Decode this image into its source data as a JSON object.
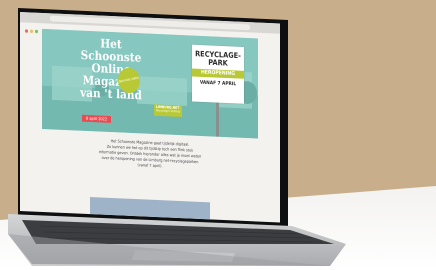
{
  "magazine": {
    "title_lines": [
      "Het",
      "Schoonste",
      "Online",
      "Magazine",
      "van 't land"
    ],
    "date_badge": "8 april 2022",
    "special_badge": "Speciale editie",
    "brand_name": "LIMBURG.NET",
    "brand_sub": "Recyclage Limburg"
  },
  "sign": {
    "line1": "RECYCLAGE-",
    "line2": "PARK",
    "line3": "HEROPENING",
    "line4": "VANAF 7 APRIL"
  },
  "intro_lines": [
    "Het Schoonste Magazine gaat tijdelijk digitaal.",
    "Zo kunnen we het op dit tijdstip toch een flink stuk",
    "informatie geven. Ontdek hieronder alles wat je moet weten",
    "over de heropening van de Limburg.net-recyclageparken",
    "(vanaf 7 april)."
  ],
  "colors": {
    "hero_bg": "#86c8bf",
    "accent_green": "#b9c935",
    "date_red": "#e94b52",
    "cta_blue": "#9fb3c8"
  }
}
